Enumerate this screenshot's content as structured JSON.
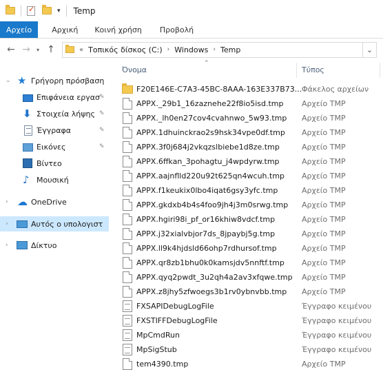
{
  "window": {
    "title": "Temp"
  },
  "ribbon": {
    "tabs": [
      "Αρχείο",
      "Αρχική",
      "Κοινή χρήση",
      "Προβολή"
    ]
  },
  "address": {
    "overflow": "«",
    "crumbs": [
      "Τοπικός δίσκος (C:)",
      "Windows",
      "Temp"
    ]
  },
  "nav": {
    "items": [
      {
        "label": "Γρήγορη πρόσβαση",
        "icon": "quick-access-star-icon"
      },
      {
        "label": "Επιφάνεια εργασ",
        "icon": "desktop-icon",
        "pinned": true
      },
      {
        "label": "Στοιχεία λήψης",
        "icon": "downloads-icon",
        "pinned": true
      },
      {
        "label": "Έγγραφα",
        "icon": "documents-icon",
        "pinned": true
      },
      {
        "label": "Εικόνες",
        "icon": "pictures-icon",
        "pinned": true
      },
      {
        "label": "Βίντεο",
        "icon": "videos-icon"
      },
      {
        "label": "Μουσική",
        "icon": "music-icon"
      },
      {
        "label": "OneDrive",
        "icon": "onedrive-icon"
      },
      {
        "label": "Αυτός ο υπολογιστ",
        "icon": "this-pc-icon",
        "selected": true
      },
      {
        "label": "Δίκτυο",
        "icon": "network-icon"
      }
    ]
  },
  "list": {
    "columns": {
      "name": "Όνομα",
      "type": "Τύπος"
    },
    "files": [
      {
        "name": "F20E146E-C7A3-45BC-8AAA-163E337B73...",
        "type": "Φάκελος αρχείων",
        "kind": "folder"
      },
      {
        "name": "APPX._29b1_16zaznehe22f8io5isd.tmp",
        "type": "Αρχείο TMP",
        "kind": "file"
      },
      {
        "name": "APPX._lh0en27cov4cvahnwo_5w93.tmp",
        "type": "Αρχείο TMP",
        "kind": "file"
      },
      {
        "name": "APPX.1dhuinckrao2s9hsk34vpe0df.tmp",
        "type": "Αρχείο TMP",
        "kind": "file"
      },
      {
        "name": "APPX.3f0j684j2vkqzslbiebe1d8ze.tmp",
        "type": "Αρχείο TMP",
        "kind": "file"
      },
      {
        "name": "APPX.6ffkan_3pohagtu_j4wpdyrw.tmp",
        "type": "Αρχείο TMP",
        "kind": "file"
      },
      {
        "name": "APPX.aajnflld220u92t625qn4wcuh.tmp",
        "type": "Αρχείο TMP",
        "kind": "file"
      },
      {
        "name": "APPX.f1keukix0lbo4iqat6gsy3yfc.tmp",
        "type": "Αρχείο TMP",
        "kind": "file"
      },
      {
        "name": "APPX.gkdxb4b4s4foo9jh4j3m0srwg.tmp",
        "type": "Αρχείο TMP",
        "kind": "file"
      },
      {
        "name": "APPX.hgiri98i_pf_or16khiw8vdcf.tmp",
        "type": "Αρχείο TMP",
        "kind": "file"
      },
      {
        "name": "APPX.j32xialvbjor7ds_8jpaybj5g.tmp",
        "type": "Αρχείο TMP",
        "kind": "file"
      },
      {
        "name": "APPX.ll9k4hjdsld66ohp7rdhursof.tmp",
        "type": "Αρχείο TMP",
        "kind": "file"
      },
      {
        "name": "APPX.qr8zb1bhu0k0kamsjdv5nnftf.tmp",
        "type": "Αρχείο TMP",
        "kind": "file"
      },
      {
        "name": "APPX.qyq2pwdt_3u2qh4a2av3xfqwe.tmp",
        "type": "Αρχείο TMP",
        "kind": "file"
      },
      {
        "name": "APPX.z8jhy5zfwoegs3b1rv0ybnvbb.tmp",
        "type": "Αρχείο TMP",
        "kind": "file"
      },
      {
        "name": "FXSAPIDebugLogFile",
        "type": "Έγγραφο κειμένου",
        "kind": "text"
      },
      {
        "name": "FXSTIFFDebugLogFile",
        "type": "Έγγραφο κειμένου",
        "kind": "text"
      },
      {
        "name": "MpCmdRun",
        "type": "Έγγραφο κειμένου",
        "kind": "text"
      },
      {
        "name": "MpSigStub",
        "type": "Έγγραφο κειμένου",
        "kind": "text"
      },
      {
        "name": "tem4390.tmp",
        "type": "Αρχείο TMP",
        "kind": "file"
      }
    ]
  }
}
